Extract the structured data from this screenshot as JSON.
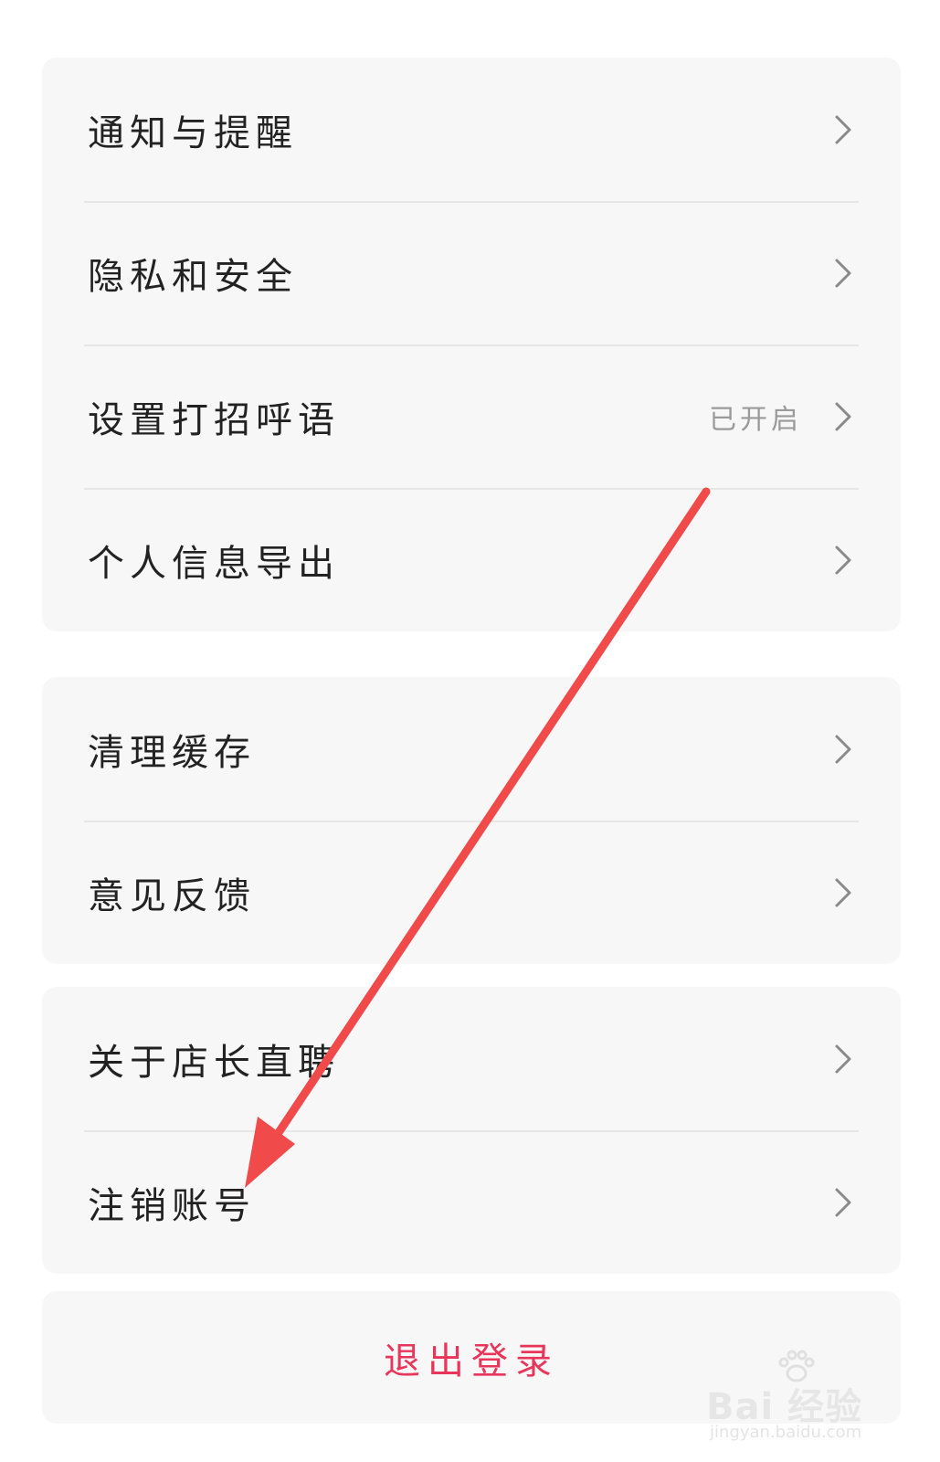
{
  "settings_groups": [
    {
      "items": [
        {
          "label": "通知与提醒",
          "value": ""
        },
        {
          "label": "隐私和安全",
          "value": ""
        },
        {
          "label": "设置打招呼语",
          "value": "已开启"
        },
        {
          "label": "个人信息导出",
          "value": ""
        }
      ]
    },
    {
      "items": [
        {
          "label": "清理缓存",
          "value": ""
        },
        {
          "label": "意见反馈",
          "value": ""
        }
      ]
    },
    {
      "items": [
        {
          "label": "关于店长直聘",
          "value": ""
        },
        {
          "label": "注销账号",
          "value": ""
        }
      ]
    }
  ],
  "logout_label": "退出登录",
  "icons": {
    "row_chevron": "chevron-right-icon"
  },
  "colors": {
    "background": "#ffffff",
    "group_background": "#f7f7f7",
    "divider": "#e6e6e6",
    "label_text": "#222222",
    "value_text": "#9a9a9a",
    "logout_text": "#e8365a",
    "annotation_arrow": "#f04a4a"
  },
  "watermark": {
    "logo_text": "Bai 经验",
    "url_text": "jingyan.baidu.com"
  }
}
